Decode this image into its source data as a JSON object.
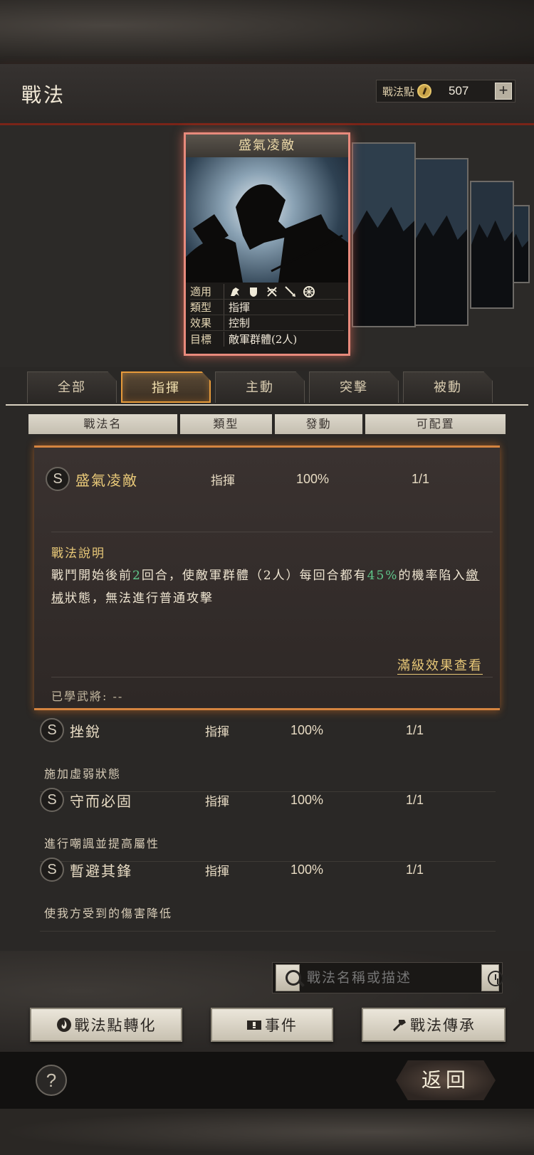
{
  "header": {
    "title": "戰法",
    "points_label": "戰法點",
    "points_value": "507",
    "add_label": "+"
  },
  "card": {
    "name": "盛氣凌敵",
    "rows": [
      {
        "key": "適用",
        "value": ""
      },
      {
        "key": "類型",
        "value": "指揮"
      },
      {
        "key": "效果",
        "value": "控制"
      },
      {
        "key": "目標",
        "value": "敵軍群體(2人)"
      }
    ],
    "applicable_icons": [
      "cavalry-icon",
      "shield-icon",
      "bow-icon",
      "spear-icon",
      "wheel-icon"
    ]
  },
  "tabs": [
    "全部",
    "指揮",
    "主動",
    "突擊",
    "被動"
  ],
  "active_tab": "指揮",
  "columns": [
    "戰法名",
    "類型",
    "發動",
    "可配置"
  ],
  "tactics": [
    {
      "grade": "S",
      "name": "盛氣凌敵",
      "type": "指揮",
      "rate": "100%",
      "config": "1/1"
    },
    {
      "grade": "S",
      "name": "挫銳",
      "type": "指揮",
      "rate": "100%",
      "config": "1/1",
      "desc": "施加虛弱狀態"
    },
    {
      "grade": "S",
      "name": "守而必固",
      "type": "指揮",
      "rate": "100%",
      "config": "1/1",
      "desc": "進行嘲諷並提高屬性"
    },
    {
      "grade": "S",
      "name": "暫避其鋒",
      "type": "指揮",
      "rate": "100%",
      "config": "1/1",
      "desc": "使我方受到的傷害降低"
    }
  ],
  "expanded": {
    "desc_title": "戰法說明",
    "desc_part1": "戰鬥開始後前",
    "desc_num1": "2",
    "desc_part2": "回合，使敵軍群體（2人）每回合都有",
    "desc_num2": "45%",
    "desc_part3": "的機率陷入",
    "desc_link": "繳械",
    "desc_part4": "狀態，無法進行普通攻擊",
    "max_link": "滿級效果查看",
    "learned": "已學武將: --"
  },
  "search": {
    "placeholder": "戰法名稱或描述"
  },
  "buttons": {
    "convert": "戰法點轉化",
    "event": "事件",
    "inherit": "戰法傳承",
    "help": "?",
    "return": "返回"
  },
  "colors": {
    "accent_gold": "#e8c878",
    "highlight_orange": "#d48440",
    "card_border": "#e88a7c",
    "green_number": "#5fc68a"
  }
}
